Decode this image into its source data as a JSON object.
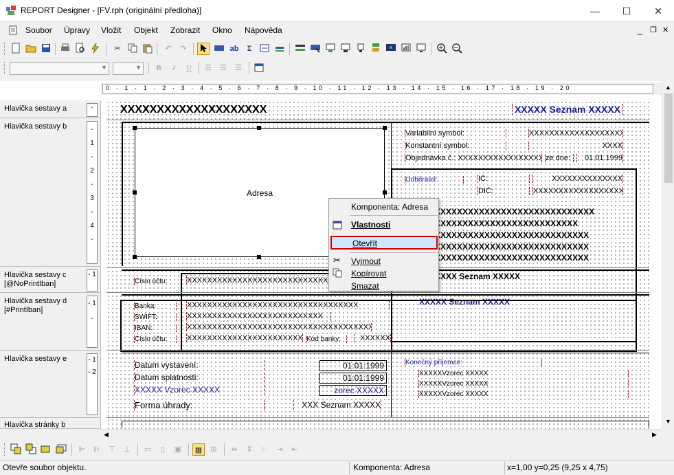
{
  "window": {
    "title": "REPORT Designer - [FV.rph (originální předloha)]",
    "minimize": "—",
    "maximize": "☐",
    "close": "✕"
  },
  "menu": [
    "Soubor",
    "Úpravy",
    "Vložit",
    "Objekt",
    "Zobrazit",
    "Okno",
    "Nápověda"
  ],
  "mdi": {
    "min": "_",
    "restore": "❐",
    "close": "✕"
  },
  "format": {
    "bold": "B",
    "italic": "I",
    "underline": "U"
  },
  "ruler": "0 · 1 · 1 · 2 · 3 · 4 · 5 · 6 · 7 · 8 · 9 · 10 · 11 · 12 · 13 · 14 · 15 · 16 · 17 · 18 · 19 · 20",
  "bands": [
    {
      "label": "Hlavička sestavy a",
      "ticks": "-"
    },
    {
      "label": "Hlavička sestavy b",
      "ticks": "- 1 - 2 - 3 - 4 -"
    },
    {
      "label": "Hlavička sestavy c [@NoPrintIban]",
      "ticks": "- 1"
    },
    {
      "label": "Hlavička sestavy d [#PrintIban]",
      "ticks": "- 1 -"
    },
    {
      "label": "Hlavička sestavy e",
      "ticks": "- 1 - 2"
    },
    {
      "label": "Hlavička stránky b",
      "ticks": "-"
    }
  ],
  "report": {
    "header_left": "XXXXXXXXXXXXXXXXXXXX",
    "header_right": "XXXXX Seznam XXXXX",
    "address": "Adresa",
    "var_symbol": "Variabilní symbol:",
    "var_symbol_val": "XXXXXXXXXXXXXXXXXXXX",
    "const_symbol": "Konstantní symbol:",
    "const_symbol_val": "XXXX",
    "order": "Objednávka č.: XXXXXXXXXXXXXXXXXX",
    "order_date_lbl": "ze dne:",
    "order_date": "01.01.1999",
    "customer": "Odběratel:",
    "ic": "IČ:",
    "ic_val": "XXXXXXXXXXXXXX",
    "dic": "DIČ:",
    "dic_val": "XXXXXXXXXXXXXXXXXXXX",
    "customer_lines": [
      "XXXXXXXXXXXXXXXXXXXXXXXXXXXXXX",
      "XXXXXXXXXXXXXXXXXXXXXXXXXXX",
      "XXXXXXXXXXXXXXXXXXXXXXXXXXXXX",
      "XXXXXXXXXXXXXXXXXXXXXXXXXXXXX",
      "XXXXXXXXXXXXXXXXXXXXXXXXXXXXX"
    ],
    "seznam1": "XXXXX Seznam XXXXX",
    "seznam2": "XXXXX Seznam XXXXX",
    "account_lbl": "Číslo účtu:",
    "account_val": "XXXXXXXXXXXXXXXXXXXXXXXXXXXXXXXX",
    "bank_lbl": "Banka:",
    "bank_val": "XXXXXXXXXXXXXXXXXXXXXXXXXXXXXXXXXX",
    "swift_lbl": "SWIFT:",
    "swift_val": "XXXXXXXXXXXXXXXXXXXXXXXXXXX",
    "iban_lbl": "IBAN:",
    "iban_val": "XXXXXXXXXXXXXXXXXXXXXXXXXXXXXXXXXXXXX",
    "account2_lbl": "Číslo účtu:",
    "account2_val": "XXXXXXXXXXXXXXXXXXXXXXX",
    "bank_code_lbl": "Kód banky:",
    "bank_code_val": "XXXXXX",
    "issue_lbl": "Datum vystavení:",
    "issue_val": "01:01:1999",
    "due_lbl": "Datum splatnosti:",
    "due_val": "01:01:1999",
    "formula_lbl": "XXXXX Vzorec XXXXX",
    "formula_val": "zorec XXXXX",
    "payment_lbl": "Forma úhrady:",
    "payment_val": "XXX Seznam XXXXX",
    "recipient": "Konečný příjemce:",
    "recipient_lines": [
      "XXXXXVzorec XXXXX",
      "XXXXXVzorec XXXXX",
      "XXXXXVzorec XXXXX"
    ]
  },
  "context_menu": {
    "header": "Komponenta: Adresa",
    "properties": "Vlastnosti",
    "open": "Otevřít",
    "cut": "Vyjmout",
    "copy": "Kopírovat",
    "delete": "Smazat"
  },
  "status": {
    "hint": "Otevře soubor objektu.",
    "component": "Komponenta: Adresa",
    "coords": "x=1,00  y=0,25  (9,25 x 4,75)"
  },
  "colors": {
    "highlight": "#cce8ff",
    "open_border": "#d00000",
    "blue_text": "#1a1a9e"
  }
}
